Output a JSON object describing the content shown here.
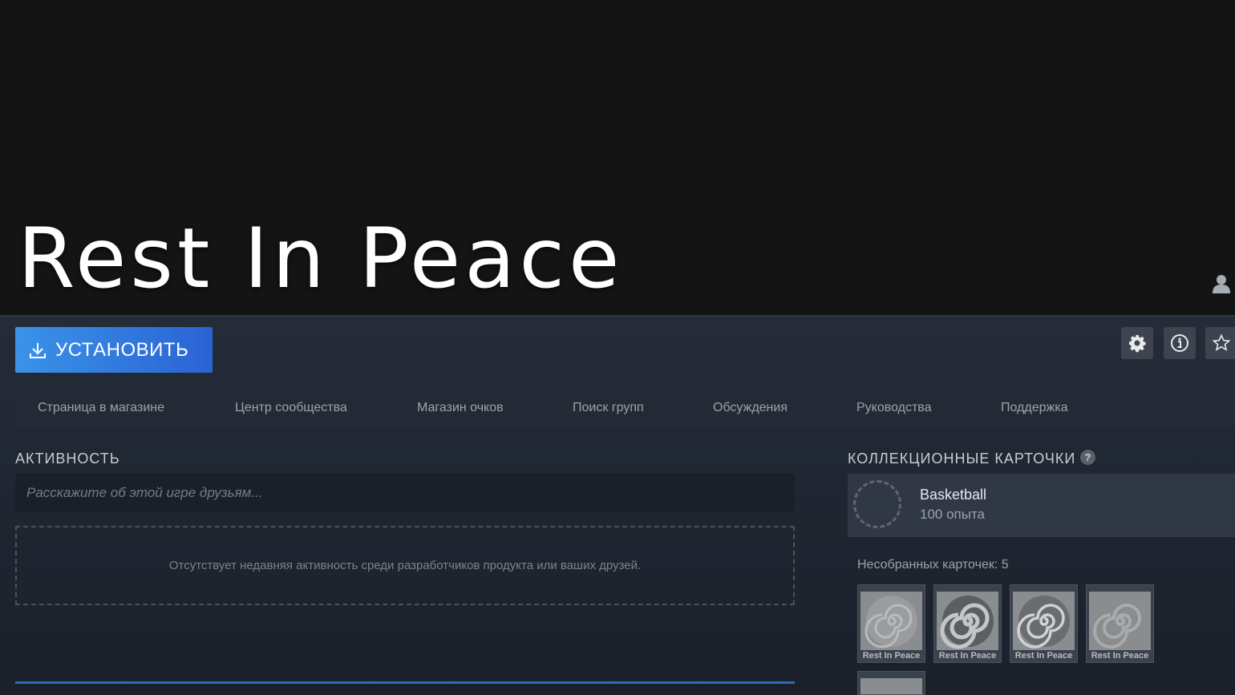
{
  "game": {
    "title": "Rest In Peace"
  },
  "toolbar": {
    "install_label": "УСТАНОВИТЬ"
  },
  "nav": {
    "items": [
      "Страница в магазине",
      "Центр сообщества",
      "Магазин очков",
      "Поиск групп",
      "Обсуждения",
      "Руководства",
      "Поддержка"
    ]
  },
  "activity": {
    "title": "АКТИВНОСТЬ",
    "input_placeholder": "Расскажите об этой игре друзьям...",
    "empty_text": "Отсутствует недавняя активность среди разработчиков продукта или ваших друзей."
  },
  "cards": {
    "title": "КОЛЛЕКЦИОННЫЕ КАРТОЧКИ",
    "help": "?",
    "badge_name": "Basketball",
    "badge_xp": "100 опыта",
    "uncollected": "Несобранных карточек: 5",
    "items": [
      {
        "label": "Rest In Peace"
      },
      {
        "label": "Rest In Peace"
      },
      {
        "label": "Rest In Peace"
      },
      {
        "label": "Rest In Peace"
      }
    ]
  },
  "colors": {
    "accent": "#2a63d4",
    "panel_bg": "#242c38"
  },
  "icons": [
    "user-icon",
    "download-icon",
    "gear-icon",
    "info-icon",
    "star-icon",
    "spiral-icon"
  ]
}
